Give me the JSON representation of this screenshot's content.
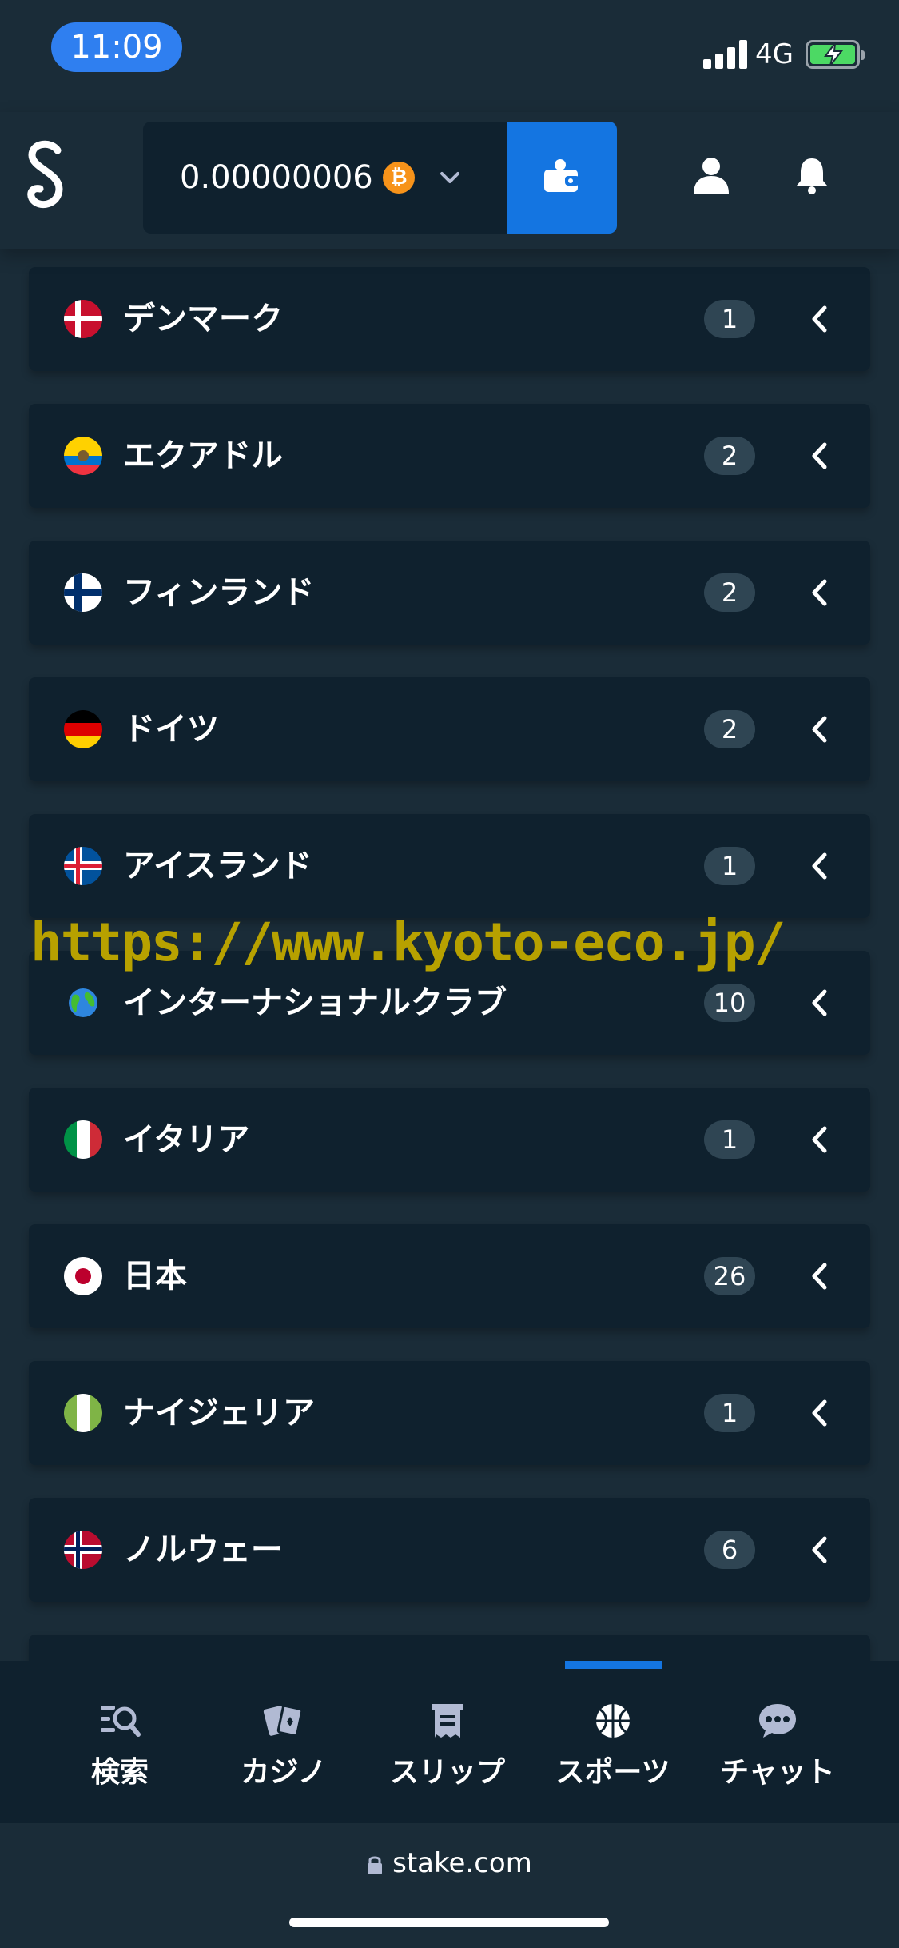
{
  "status": {
    "time": "11:09",
    "network": "4G"
  },
  "header": {
    "balance": "0.00000006",
    "currency_icon": "bitcoin-icon"
  },
  "countries": [
    {
      "name": "デンマーク",
      "count": "1",
      "flag": "denmark"
    },
    {
      "name": "エクアドル",
      "count": "2",
      "flag": "ecuador"
    },
    {
      "name": "フィンランド",
      "count": "2",
      "flag": "finland"
    },
    {
      "name": "ドイツ",
      "count": "2",
      "flag": "germany"
    },
    {
      "name": "アイスランド",
      "count": "1",
      "flag": "iceland"
    },
    {
      "name": "インターナショナルクラブ",
      "count": "10",
      "flag": "globe"
    },
    {
      "name": "イタリア",
      "count": "1",
      "flag": "italy"
    },
    {
      "name": "日本",
      "count": "26",
      "flag": "japan"
    },
    {
      "name": "ナイジェリア",
      "count": "1",
      "flag": "nigeria"
    },
    {
      "name": "ノルウェー",
      "count": "6",
      "flag": "norway"
    }
  ],
  "watermark": "https://www.kyoto-eco.jp/",
  "nav": {
    "search": "検索",
    "casino": "カジノ",
    "slip": "スリップ",
    "sports": "スポーツ",
    "chat": "チャット",
    "active": "sports"
  },
  "browser": {
    "url": "stake.com"
  },
  "colors": {
    "accent": "#1475e1",
    "background": "#1a2c38",
    "card": "#0f212e",
    "badge": "#2f4553"
  }
}
